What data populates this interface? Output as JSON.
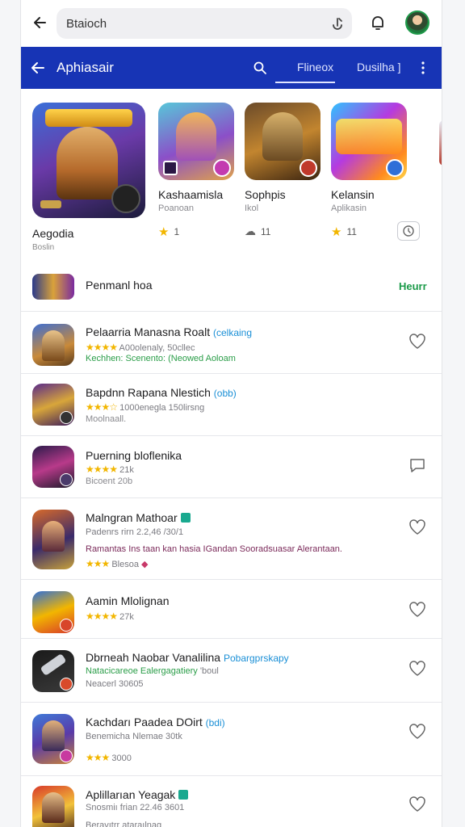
{
  "search": {
    "value": "Btaioch"
  },
  "header": {
    "title": "Aphiasair",
    "tabs": [
      "Flineox",
      "Dusilha ]"
    ]
  },
  "featured": {
    "big": {
      "label": "Aegodia",
      "sub": "Boslin"
    },
    "cards": [
      {
        "name": "Kashaamisla",
        "sub": "Poanoan",
        "rating": "1"
      },
      {
        "name": "Sophpis",
        "sub": "Ikol",
        "rating": "11"
      },
      {
        "name": "Kelansin",
        "sub": "Aplikasin",
        "rating": "11"
      }
    ]
  },
  "premium": {
    "label": "Penmanl hoa",
    "action": "Heurr"
  },
  "apps": [
    {
      "title": "Pelaarria Manasna Roalt",
      "tag": "(celkaing",
      "meta_stars": "★★★★",
      "meta": "A00olenaly, 50cllec",
      "sub": "Kechhen: Scenento: (Neowed Aoloam"
    },
    {
      "title": "Bapdnn Rapana Nlestich",
      "tag": "(obb)",
      "meta_stars": "★★★☆",
      "meta": "1000enegla 150lirsng",
      "sub": "Moolnaall."
    },
    {
      "title": "Puerning bloflenika",
      "tag": "",
      "meta_stars": "★★★★",
      "meta": "21k",
      "sub": "Bicoent 20b"
    },
    {
      "title": "Malngran Mathoar",
      "tag": "",
      "meta_stars": "",
      "meta": "Padenrs rirn 2.2,46 /30/1",
      "desc": "Ramantas Ins taan kan hasia IGandan Sooradsuasar Alerantaan.",
      "sub_stars": "★★★",
      "sub": "Blesoa"
    },
    {
      "title": "Aamin Mlolignan",
      "tag": "",
      "meta_stars": "★★★★",
      "meta": "27k",
      "sub": ""
    },
    {
      "title": "Dbrneah Naobar Vanalilina",
      "tag": "Pobargprskapy",
      "meta_stars": "",
      "meta": "Natacicareoe Ealergagatiery",
      "meta_tail": "'boul",
      "sub": "Neacerl 30605"
    },
    {
      "title": "Kachdarı Paadea DOirt",
      "tag": "(bdi)",
      "meta_stars": "",
      "meta": "Benemicha Nlemae 30tk",
      "sub_stars": "★★★",
      "sub": "3000"
    },
    {
      "title": "Aplillarıan Yeagak",
      "tag": "",
      "meta_stars": "",
      "meta": "Snosmiı frian 22.46 3601",
      "sub": "Beravıtrr ataraılnag"
    }
  ],
  "colors": {
    "brand": "#1734b5",
    "accent_green": "#1a9a48",
    "star": "#f2b600"
  }
}
